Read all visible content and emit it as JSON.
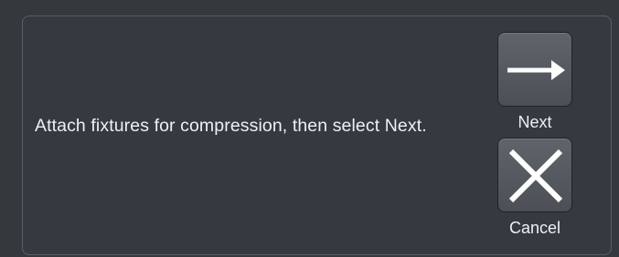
{
  "dialog": {
    "message": "Attach fixtures for compression, then select Next."
  },
  "actions": {
    "next": {
      "label": "Next",
      "icon": "arrow-right-icon"
    },
    "cancel": {
      "label": "Cancel",
      "icon": "close-icon"
    }
  },
  "colors": {
    "background": "#35383d",
    "panel_border": "#5a5e64",
    "button_face": "#565a60",
    "text": "#eef0f2",
    "icon": "#ffffff"
  }
}
